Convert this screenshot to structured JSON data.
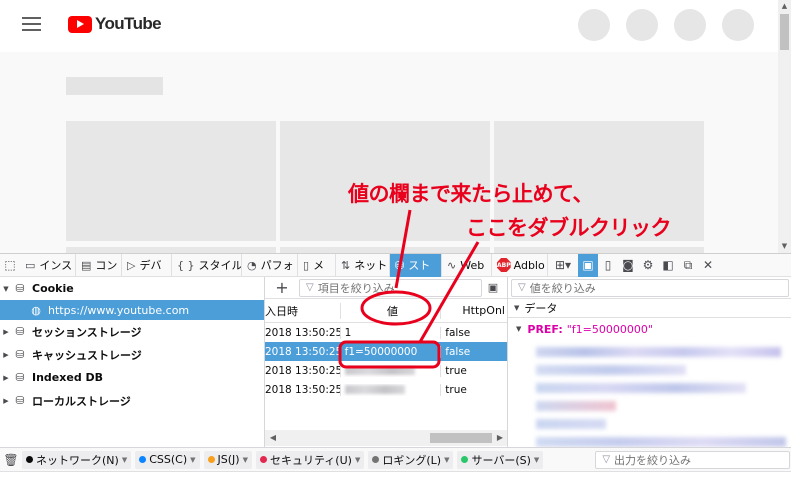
{
  "page": {
    "logo_text": "YouTube"
  },
  "annotations": {
    "line1": "値の欄まで来たら止めて、",
    "line2": "ここをダブルクリック",
    "color": "#e8001c"
  },
  "devtools": {
    "tabs": [
      {
        "icon": "inspector-icon",
        "glyph": "▭",
        "label": "インス"
      },
      {
        "icon": "console-icon",
        "glyph": "▤",
        "label": "コン"
      },
      {
        "icon": "debugger-icon",
        "glyph": "▷",
        "label": "デバ"
      },
      {
        "icon": "style-editor-icon",
        "glyph": "{ }",
        "label": "スタイル"
      },
      {
        "icon": "performance-icon",
        "glyph": "◔",
        "label": "パフォ"
      },
      {
        "icon": "memory-icon",
        "glyph": "▯",
        "label": "メ"
      },
      {
        "icon": "network-icon",
        "glyph": "⇅",
        "label": "ネット"
      },
      {
        "icon": "storage-icon",
        "glyph": "⛁",
        "label": "スト"
      },
      {
        "icon": "web-icon",
        "glyph": "∿",
        "label": "Web"
      },
      {
        "icon": "adblock-icon",
        "glyph": "ABP",
        "label": "Adblo"
      }
    ],
    "accent": "#4c9ed9"
  },
  "tree": {
    "cookie_label": "Cookie",
    "cookie_child": "https://www.youtube.com",
    "items": [
      "セッションストレージ",
      "キャッシュストレージ",
      "Indexed DB",
      "ローカルストレージ"
    ]
  },
  "table": {
    "filter_placeholder": "項目を絞り込み",
    "headers": [
      "入日時",
      "値",
      "HttpOnl"
    ],
    "rows": [
      {
        "date": "2018 13:50:25...",
        "value": "1",
        "httponly": "false"
      },
      {
        "date": "2018 13:50:25...",
        "value": "f1=50000000",
        "httponly": "false"
      },
      {
        "date": "2018 13:50:25...",
        "value": "",
        "httponly": "true"
      },
      {
        "date": "2018 13:50:25...",
        "value": "",
        "httponly": "true"
      }
    ]
  },
  "data_panel": {
    "filter_placeholder": "値を絞り込み",
    "section": "データ",
    "pref_key": "PREF:",
    "pref_value": "\"f1=50000000\""
  },
  "console": {
    "chips": [
      {
        "label": "ネットワーク(N)",
        "color": "#0c0c0d"
      },
      {
        "label": "CSS(C)",
        "color": "#0a84ff"
      },
      {
        "label": "JS(J)",
        "color": "#f89f1b"
      },
      {
        "label": "セキュリティ(U)",
        "color": "#e22850"
      },
      {
        "label": "ロギング(L)",
        "color": "#737373"
      },
      {
        "label": "サーバー(S)",
        "color": "#2ac769"
      }
    ],
    "filter_placeholder": "出力を絞り込み"
  }
}
